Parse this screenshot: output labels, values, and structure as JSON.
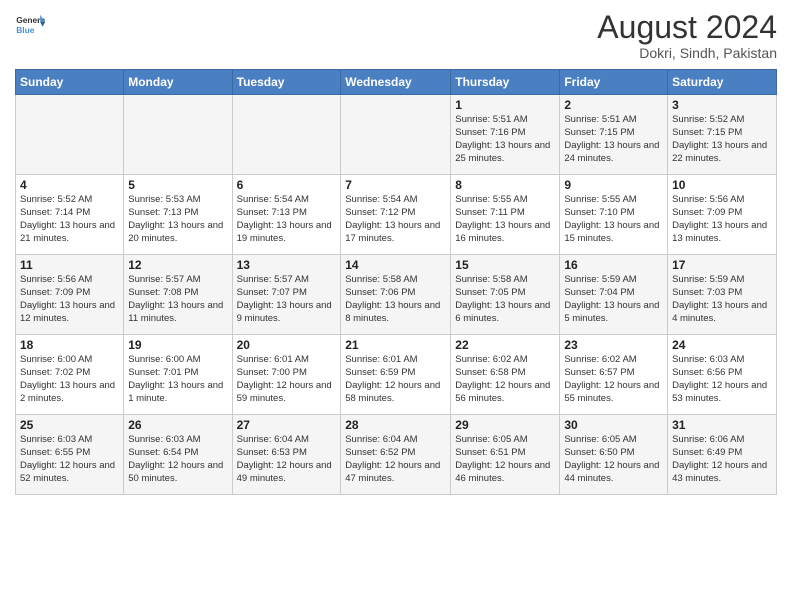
{
  "header": {
    "logo_line1": "General",
    "logo_line2": "Blue",
    "month_year": "August 2024",
    "location": "Dokri, Sindh, Pakistan"
  },
  "weekdays": [
    "Sunday",
    "Monday",
    "Tuesday",
    "Wednesday",
    "Thursday",
    "Friday",
    "Saturday"
  ],
  "weeks": [
    [
      {
        "day": "",
        "sunrise": "",
        "sunset": "",
        "daylight": ""
      },
      {
        "day": "",
        "sunrise": "",
        "sunset": "",
        "daylight": ""
      },
      {
        "day": "",
        "sunrise": "",
        "sunset": "",
        "daylight": ""
      },
      {
        "day": "",
        "sunrise": "",
        "sunset": "",
        "daylight": ""
      },
      {
        "day": "1",
        "sunrise": "Sunrise: 5:51 AM",
        "sunset": "Sunset: 7:16 PM",
        "daylight": "Daylight: 13 hours and 25 minutes."
      },
      {
        "day": "2",
        "sunrise": "Sunrise: 5:51 AM",
        "sunset": "Sunset: 7:15 PM",
        "daylight": "Daylight: 13 hours and 24 minutes."
      },
      {
        "day": "3",
        "sunrise": "Sunrise: 5:52 AM",
        "sunset": "Sunset: 7:15 PM",
        "daylight": "Daylight: 13 hours and 22 minutes."
      }
    ],
    [
      {
        "day": "4",
        "sunrise": "Sunrise: 5:52 AM",
        "sunset": "Sunset: 7:14 PM",
        "daylight": "Daylight: 13 hours and 21 minutes."
      },
      {
        "day": "5",
        "sunrise": "Sunrise: 5:53 AM",
        "sunset": "Sunset: 7:13 PM",
        "daylight": "Daylight: 13 hours and 20 minutes."
      },
      {
        "day": "6",
        "sunrise": "Sunrise: 5:54 AM",
        "sunset": "Sunset: 7:13 PM",
        "daylight": "Daylight: 13 hours and 19 minutes."
      },
      {
        "day": "7",
        "sunrise": "Sunrise: 5:54 AM",
        "sunset": "Sunset: 7:12 PM",
        "daylight": "Daylight: 13 hours and 17 minutes."
      },
      {
        "day": "8",
        "sunrise": "Sunrise: 5:55 AM",
        "sunset": "Sunset: 7:11 PM",
        "daylight": "Daylight: 13 hours and 16 minutes."
      },
      {
        "day": "9",
        "sunrise": "Sunrise: 5:55 AM",
        "sunset": "Sunset: 7:10 PM",
        "daylight": "Daylight: 13 hours and 15 minutes."
      },
      {
        "day": "10",
        "sunrise": "Sunrise: 5:56 AM",
        "sunset": "Sunset: 7:09 PM",
        "daylight": "Daylight: 13 hours and 13 minutes."
      }
    ],
    [
      {
        "day": "11",
        "sunrise": "Sunrise: 5:56 AM",
        "sunset": "Sunset: 7:09 PM",
        "daylight": "Daylight: 13 hours and 12 minutes."
      },
      {
        "day": "12",
        "sunrise": "Sunrise: 5:57 AM",
        "sunset": "Sunset: 7:08 PM",
        "daylight": "Daylight: 13 hours and 11 minutes."
      },
      {
        "day": "13",
        "sunrise": "Sunrise: 5:57 AM",
        "sunset": "Sunset: 7:07 PM",
        "daylight": "Daylight: 13 hours and 9 minutes."
      },
      {
        "day": "14",
        "sunrise": "Sunrise: 5:58 AM",
        "sunset": "Sunset: 7:06 PM",
        "daylight": "Daylight: 13 hours and 8 minutes."
      },
      {
        "day": "15",
        "sunrise": "Sunrise: 5:58 AM",
        "sunset": "Sunset: 7:05 PM",
        "daylight": "Daylight: 13 hours and 6 minutes."
      },
      {
        "day": "16",
        "sunrise": "Sunrise: 5:59 AM",
        "sunset": "Sunset: 7:04 PM",
        "daylight": "Daylight: 13 hours and 5 minutes."
      },
      {
        "day": "17",
        "sunrise": "Sunrise: 5:59 AM",
        "sunset": "Sunset: 7:03 PM",
        "daylight": "Daylight: 13 hours and 4 minutes."
      }
    ],
    [
      {
        "day": "18",
        "sunrise": "Sunrise: 6:00 AM",
        "sunset": "Sunset: 7:02 PM",
        "daylight": "Daylight: 13 hours and 2 minutes."
      },
      {
        "day": "19",
        "sunrise": "Sunrise: 6:00 AM",
        "sunset": "Sunset: 7:01 PM",
        "daylight": "Daylight: 13 hours and 1 minute."
      },
      {
        "day": "20",
        "sunrise": "Sunrise: 6:01 AM",
        "sunset": "Sunset: 7:00 PM",
        "daylight": "Daylight: 12 hours and 59 minutes."
      },
      {
        "day": "21",
        "sunrise": "Sunrise: 6:01 AM",
        "sunset": "Sunset: 6:59 PM",
        "daylight": "Daylight: 12 hours and 58 minutes."
      },
      {
        "day": "22",
        "sunrise": "Sunrise: 6:02 AM",
        "sunset": "Sunset: 6:58 PM",
        "daylight": "Daylight: 12 hours and 56 minutes."
      },
      {
        "day": "23",
        "sunrise": "Sunrise: 6:02 AM",
        "sunset": "Sunset: 6:57 PM",
        "daylight": "Daylight: 12 hours and 55 minutes."
      },
      {
        "day": "24",
        "sunrise": "Sunrise: 6:03 AM",
        "sunset": "Sunset: 6:56 PM",
        "daylight": "Daylight: 12 hours and 53 minutes."
      }
    ],
    [
      {
        "day": "25",
        "sunrise": "Sunrise: 6:03 AM",
        "sunset": "Sunset: 6:55 PM",
        "daylight": "Daylight: 12 hours and 52 minutes."
      },
      {
        "day": "26",
        "sunrise": "Sunrise: 6:03 AM",
        "sunset": "Sunset: 6:54 PM",
        "daylight": "Daylight: 12 hours and 50 minutes."
      },
      {
        "day": "27",
        "sunrise": "Sunrise: 6:04 AM",
        "sunset": "Sunset: 6:53 PM",
        "daylight": "Daylight: 12 hours and 49 minutes."
      },
      {
        "day": "28",
        "sunrise": "Sunrise: 6:04 AM",
        "sunset": "Sunset: 6:52 PM",
        "daylight": "Daylight: 12 hours and 47 minutes."
      },
      {
        "day": "29",
        "sunrise": "Sunrise: 6:05 AM",
        "sunset": "Sunset: 6:51 PM",
        "daylight": "Daylight: 12 hours and 46 minutes."
      },
      {
        "day": "30",
        "sunrise": "Sunrise: 6:05 AM",
        "sunset": "Sunset: 6:50 PM",
        "daylight": "Daylight: 12 hours and 44 minutes."
      },
      {
        "day": "31",
        "sunrise": "Sunrise: 6:06 AM",
        "sunset": "Sunset: 6:49 PM",
        "daylight": "Daylight: 12 hours and 43 minutes."
      }
    ]
  ]
}
